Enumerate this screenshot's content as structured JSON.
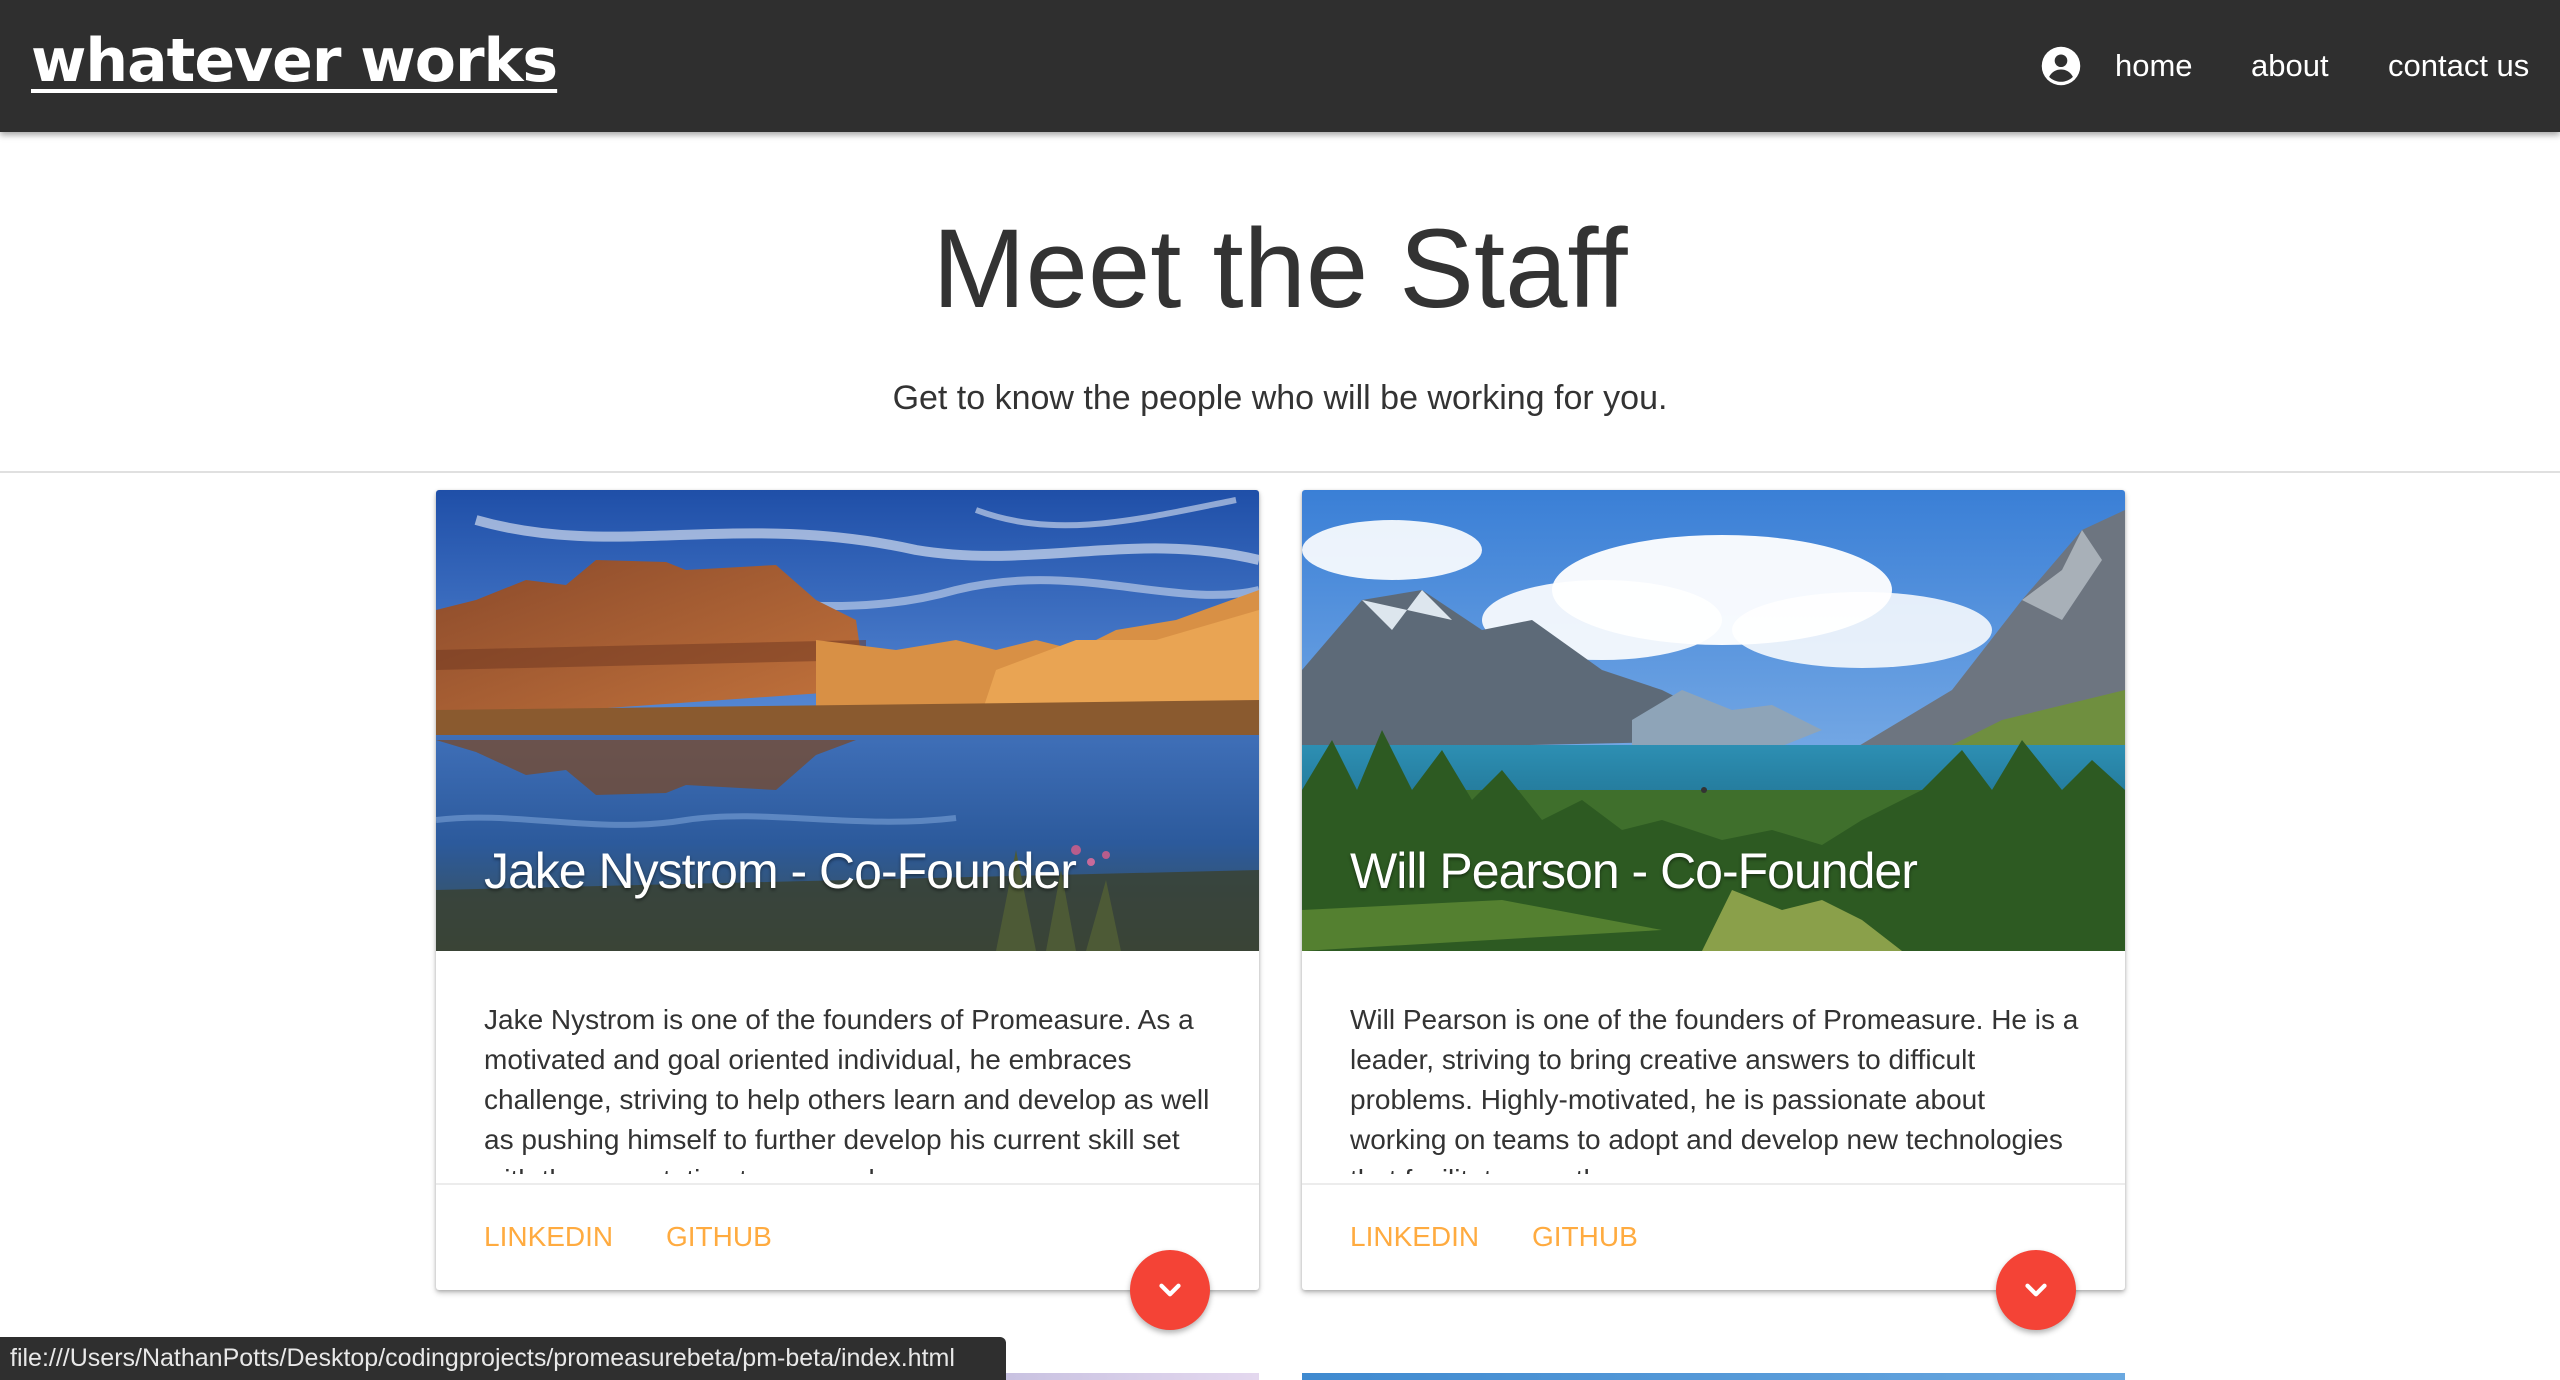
{
  "navbar": {
    "brand": "whatever works",
    "account_icon": "account-circle-icon",
    "links": [
      "home",
      "about",
      "contact us"
    ]
  },
  "header": {
    "title": "Meet the Staff",
    "subtitle": "Get to know the people who will be working for you."
  },
  "cards": [
    {
      "title": "Jake Nystrom - Co-Founder",
      "image": "canyon-lake-landscape",
      "description": "Jake Nystrom is one of the founders of Promeasure. As a motivated and goal oriented individual, he embraces challenge, striving to help others learn and develop as well as pushing himself to further develop his current skill set with the expectation to succeed.",
      "links": [
        "LINKEDIN",
        "GITHUB"
      ],
      "expand_icon": "chevron-down-icon"
    },
    {
      "title": "Will Pearson - Co-Founder",
      "image": "mountain-lake-forest-landscape",
      "description": "Will Pearson is one of the founders of Promeasure. He is a leader, striving to bring creative answers to difficult problems. Highly-motivated, he is passionate about working on teams to adopt and develop new technologies that facilitate growth.",
      "links": [
        "LINKEDIN",
        "GITHUB"
      ],
      "expand_icon": "chevron-down-icon"
    }
  ],
  "status_bar": {
    "url": "file:///Users/NathanPotts/Desktop/codingprojects/promeasurebeta/pm-beta/index.html"
  },
  "colors": {
    "navbar": "#2f2f2f",
    "link_accent": "#ffab40",
    "fab": "#f44336"
  }
}
